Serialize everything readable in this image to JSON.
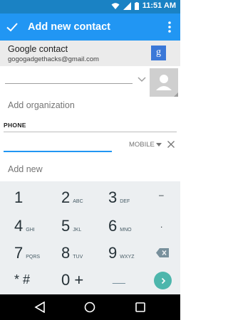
{
  "status": {
    "time": "11:51",
    "am_pm": "AM"
  },
  "app_bar": {
    "title": "Add new contact"
  },
  "account": {
    "name": "Google contact",
    "email": "gogogadgethacks@gmail.com",
    "badge": "g"
  },
  "organization": {
    "placeholder": "Add organization"
  },
  "phone": {
    "header": "PHONE",
    "type_label": "MOBILE"
  },
  "add_new": {
    "label": "Add new"
  },
  "keypad": {
    "row1": [
      {
        "num": "1",
        "letters": ""
      },
      {
        "num": "2",
        "letters": "ABC"
      },
      {
        "num": "3",
        "letters": "DEF"
      },
      {
        "num": "–",
        "letters": ""
      }
    ],
    "row2": [
      {
        "num": "4",
        "letters": "GHI"
      },
      {
        "num": "5",
        "letters": "JKL"
      },
      {
        "num": "6",
        "letters": "MNO"
      },
      {
        "num": ".",
        "letters": ""
      }
    ],
    "row3": [
      {
        "num": "7",
        "letters": "PQRS"
      },
      {
        "num": "8",
        "letters": "TUV"
      },
      {
        "num": "9",
        "letters": "WXYZ"
      }
    ],
    "row4": [
      {
        "num": "* #",
        "letters": ""
      },
      {
        "num": "0 +",
        "letters": ""
      },
      {
        "num": "__",
        "letters": ""
      }
    ]
  },
  "icons": {
    "check": "check-icon",
    "overflow": "more-vert-icon",
    "chevron": "chevron-down-icon",
    "clear": "close-icon",
    "backspace": "backspace-icon",
    "go": "chevron-right-icon",
    "back": "back-triangle-icon",
    "home": "home-circle-icon",
    "recents": "recents-square-icon"
  },
  "colors": {
    "status_bar": "#1a82c4",
    "app_bar": "#2196f3",
    "accent": "#2196f3",
    "go_button": "#4db6ac",
    "keypad_bg": "#eceff1"
  }
}
